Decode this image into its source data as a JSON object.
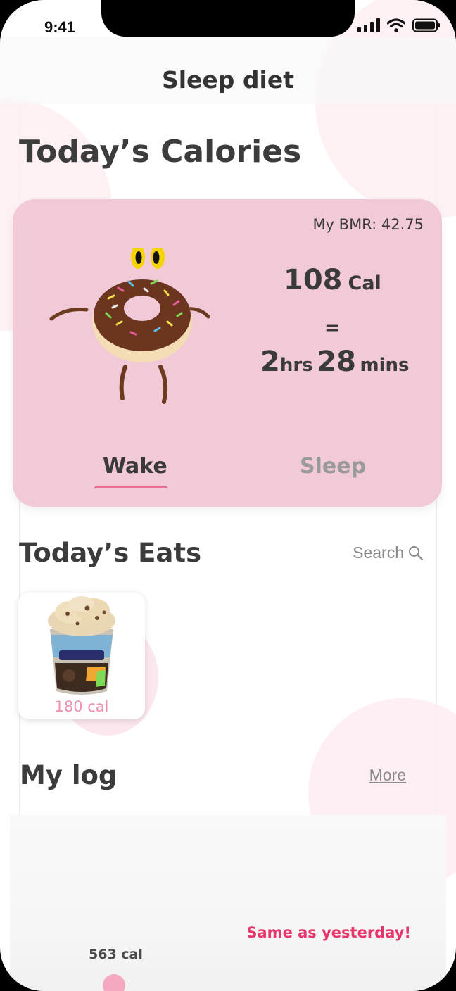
{
  "status_bar": {
    "time": "9:41"
  },
  "header": {
    "title": "Sleep diet"
  },
  "calories": {
    "title": "Today’s Calories",
    "bmr": "My BMR: 42.75",
    "value": "108",
    "value_unit": "Cal",
    "equals": "=",
    "hours": "2",
    "hours_unit": "hrs",
    "minutes": "28",
    "minutes_unit": "mins",
    "tabs": [
      {
        "label": "Wake",
        "active": true
      },
      {
        "label": "Sleep",
        "active": false
      }
    ]
  },
  "eats": {
    "title": "Today’s Eats",
    "search_label": "Search",
    "items": [
      {
        "calories": "180 cal"
      }
    ]
  },
  "log": {
    "title": "My log",
    "more_label": "More",
    "same_as_yesterday": "Same as yesterday!",
    "entry_calories": "563 cal"
  },
  "colors": {
    "card_pink": "#f2c9d7",
    "accent_pink": "#ea6f95",
    "alert_red": "#e8356b"
  }
}
